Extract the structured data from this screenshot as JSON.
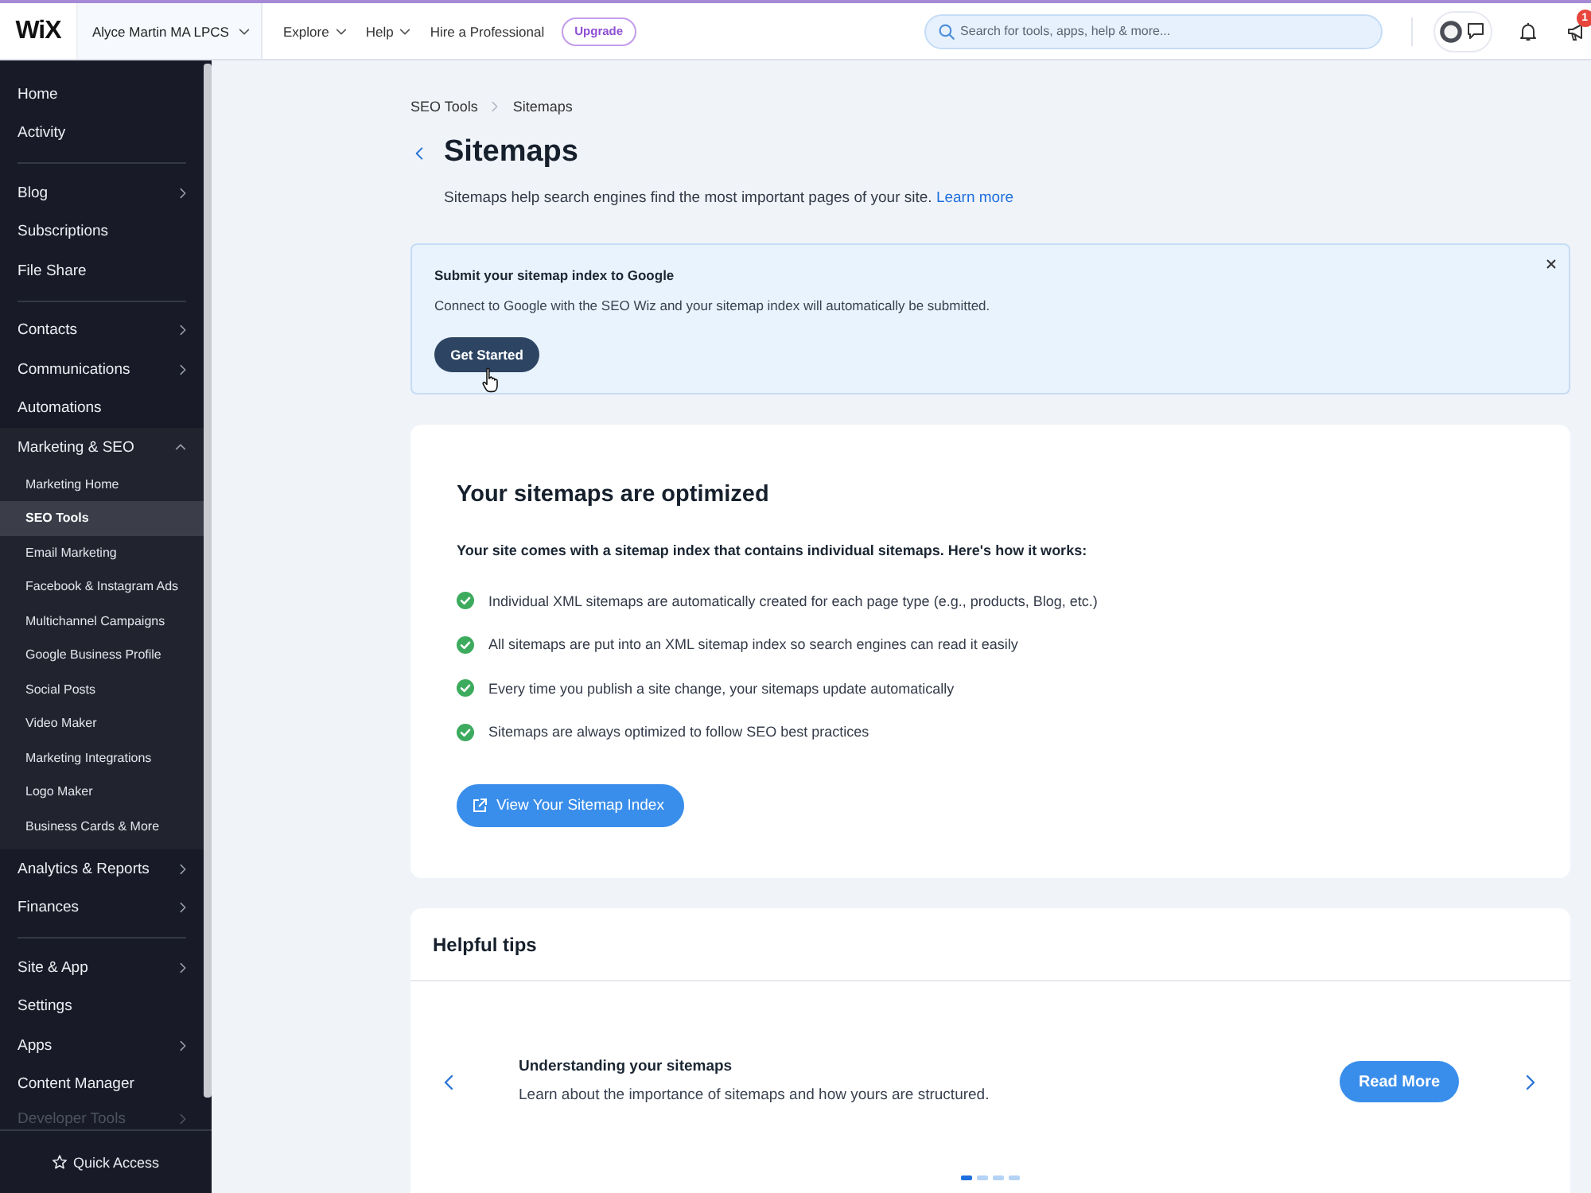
{
  "top_bar": {
    "logo": "WiX",
    "site_name": "Alyce Martin MA LPCS",
    "menu": [
      {
        "label": "Explore",
        "has_caret": true
      },
      {
        "label": "Help",
        "has_caret": true
      },
      {
        "label": "Hire a Professional",
        "has_caret": false
      }
    ],
    "upgrade_button": "Upgrade",
    "search": {
      "placeholder": "Search for tools, apps, help & more..."
    },
    "notification_badge": "1"
  },
  "sidebar": {
    "groups": [
      {
        "items": [
          {
            "label": "Home",
            "has_submenu": false,
            "selected": false
          },
          {
            "label": "Activity",
            "has_submenu": false,
            "selected": false
          }
        ]
      },
      {
        "items": [
          {
            "label": "Blog",
            "has_submenu": true,
            "expanded": false,
            "selected": false
          },
          {
            "label": "Subscriptions",
            "has_submenu": false,
            "selected": false
          },
          {
            "label": "File Share",
            "has_submenu": false,
            "selected": false
          }
        ]
      },
      {
        "items": [
          {
            "label": "Contacts",
            "has_submenu": true,
            "expanded": false,
            "selected": false
          },
          {
            "label": "Communications",
            "has_submenu": true,
            "expanded": false,
            "selected": false
          },
          {
            "label": "Automations",
            "has_submenu": false,
            "selected": false
          },
          {
            "label": "Marketing & SEO",
            "has_submenu": true,
            "expanded": true,
            "selected": false,
            "children": [
              {
                "label": "Marketing Home",
                "selected": false
              },
              {
                "label": "SEO Tools",
                "selected": true
              },
              {
                "label": "Email Marketing",
                "selected": false
              },
              {
                "label": "Facebook & Instagram Ads",
                "selected": false
              },
              {
                "label": "Multichannel Campaigns",
                "selected": false
              },
              {
                "label": "Google Business Profile",
                "selected": false
              },
              {
                "label": "Social Posts",
                "selected": false
              },
              {
                "label": "Video Maker",
                "selected": false
              },
              {
                "label": "Marketing Integrations",
                "selected": false
              },
              {
                "label": "Logo Maker",
                "selected": false
              },
              {
                "label": "Business Cards & More",
                "selected": false
              }
            ]
          },
          {
            "label": "Analytics & Reports",
            "has_submenu": true,
            "expanded": false,
            "selected": false
          },
          {
            "label": "Finances",
            "has_submenu": true,
            "expanded": false,
            "selected": false
          }
        ]
      },
      {
        "items": [
          {
            "label": "Site & App",
            "has_submenu": true,
            "expanded": false,
            "selected": false
          },
          {
            "label": "Settings",
            "has_submenu": false,
            "selected": false
          },
          {
            "label": "Apps",
            "has_submenu": true,
            "expanded": false,
            "selected": false
          },
          {
            "label": "Content Manager",
            "has_submenu": false,
            "selected": false
          }
        ]
      }
    ],
    "cut_off_item": {
      "label": "Developer Tools",
      "has_submenu": true
    },
    "quick_access": "Quick Access"
  },
  "breadcrumb": [
    "SEO Tools",
    "Sitemaps"
  ],
  "header": {
    "title": "Sitemaps",
    "description": "Sitemaps help search engines find the most important pages of your site.",
    "link": "Learn more"
  },
  "banner": {
    "title": "Submit your sitemap index to Google",
    "text": "Connect to Google with the SEO Wiz and your sitemap index will automatically be submitted.",
    "button": "Get Started"
  },
  "sitemaps_card": {
    "title": "Your sitemaps are optimized",
    "intro": "Your site comes with a sitemap index that contains individual sitemaps. Here's how it works:",
    "checklist": [
      {
        "text": "Individual XML sitemaps are automatically created for each page type (e.g., products, Blog, etc.)",
        "checked": true
      },
      {
        "text": "All sitemaps are put into an XML sitemap index so search engines can read it easily",
        "checked": true
      },
      {
        "text": "Every time you publish a site change, your sitemaps update automatically",
        "checked": true
      },
      {
        "text": "Sitemaps are always optimized to follow SEO best practices",
        "checked": true
      }
    ],
    "button": "View Your Sitemap Index"
  },
  "tips": {
    "title": "Helpful tips",
    "slide": {
      "title": "Understanding your sitemaps",
      "text": "Learn about the importance of sitemaps and how yours are structured.",
      "button": "Read More"
    },
    "dots": [
      {
        "selected": true
      },
      {
        "selected": false
      },
      {
        "selected": false
      },
      {
        "selected": false
      }
    ]
  }
}
